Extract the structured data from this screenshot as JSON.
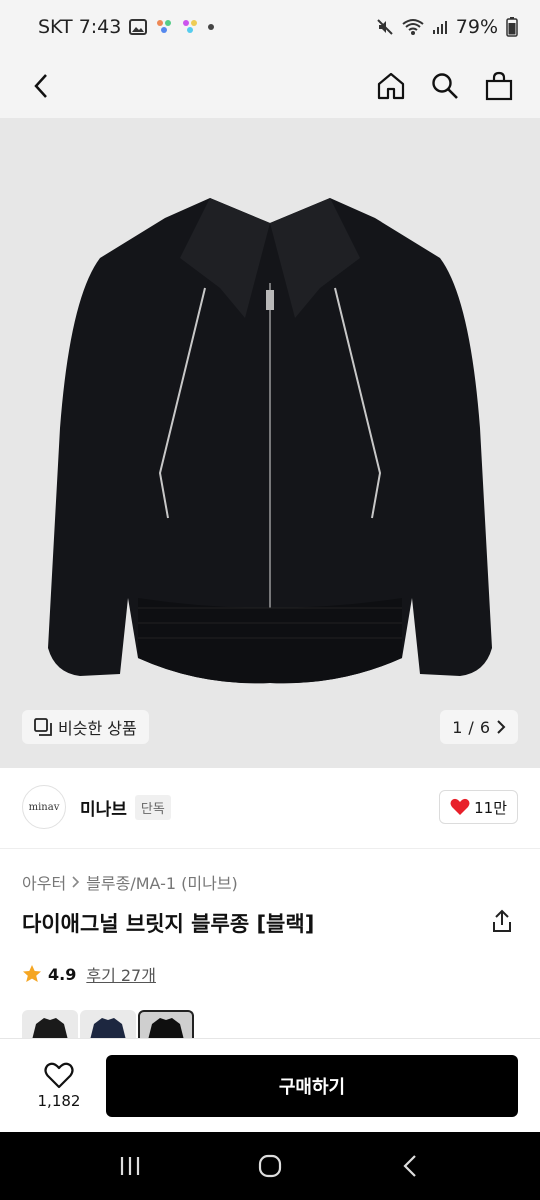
{
  "status_bar": {
    "carrier_time": "SKT 7:43",
    "battery": "79%"
  },
  "hero": {
    "similar_label": "비슷한 상품",
    "page_current": "1",
    "page_total": "6",
    "page_sep": "/"
  },
  "brand": {
    "logo_text": "minav",
    "name": "미나브",
    "badge": "단독",
    "likes": "11만"
  },
  "breadcrumb": {
    "category": "아우터",
    "subcategory": "블루종/MA-1 (미나브)"
  },
  "product": {
    "title": "다이애그널 브릿지 블루종 [블랙]",
    "rating": "4.9",
    "reviews": "후기 27개"
  },
  "bottom": {
    "wish_count": "1,182",
    "buy_label": "구매하기"
  },
  "colors": {
    "accent_heart": "#e8202a",
    "star": "#f5a623",
    "buy_bg": "#000000"
  }
}
